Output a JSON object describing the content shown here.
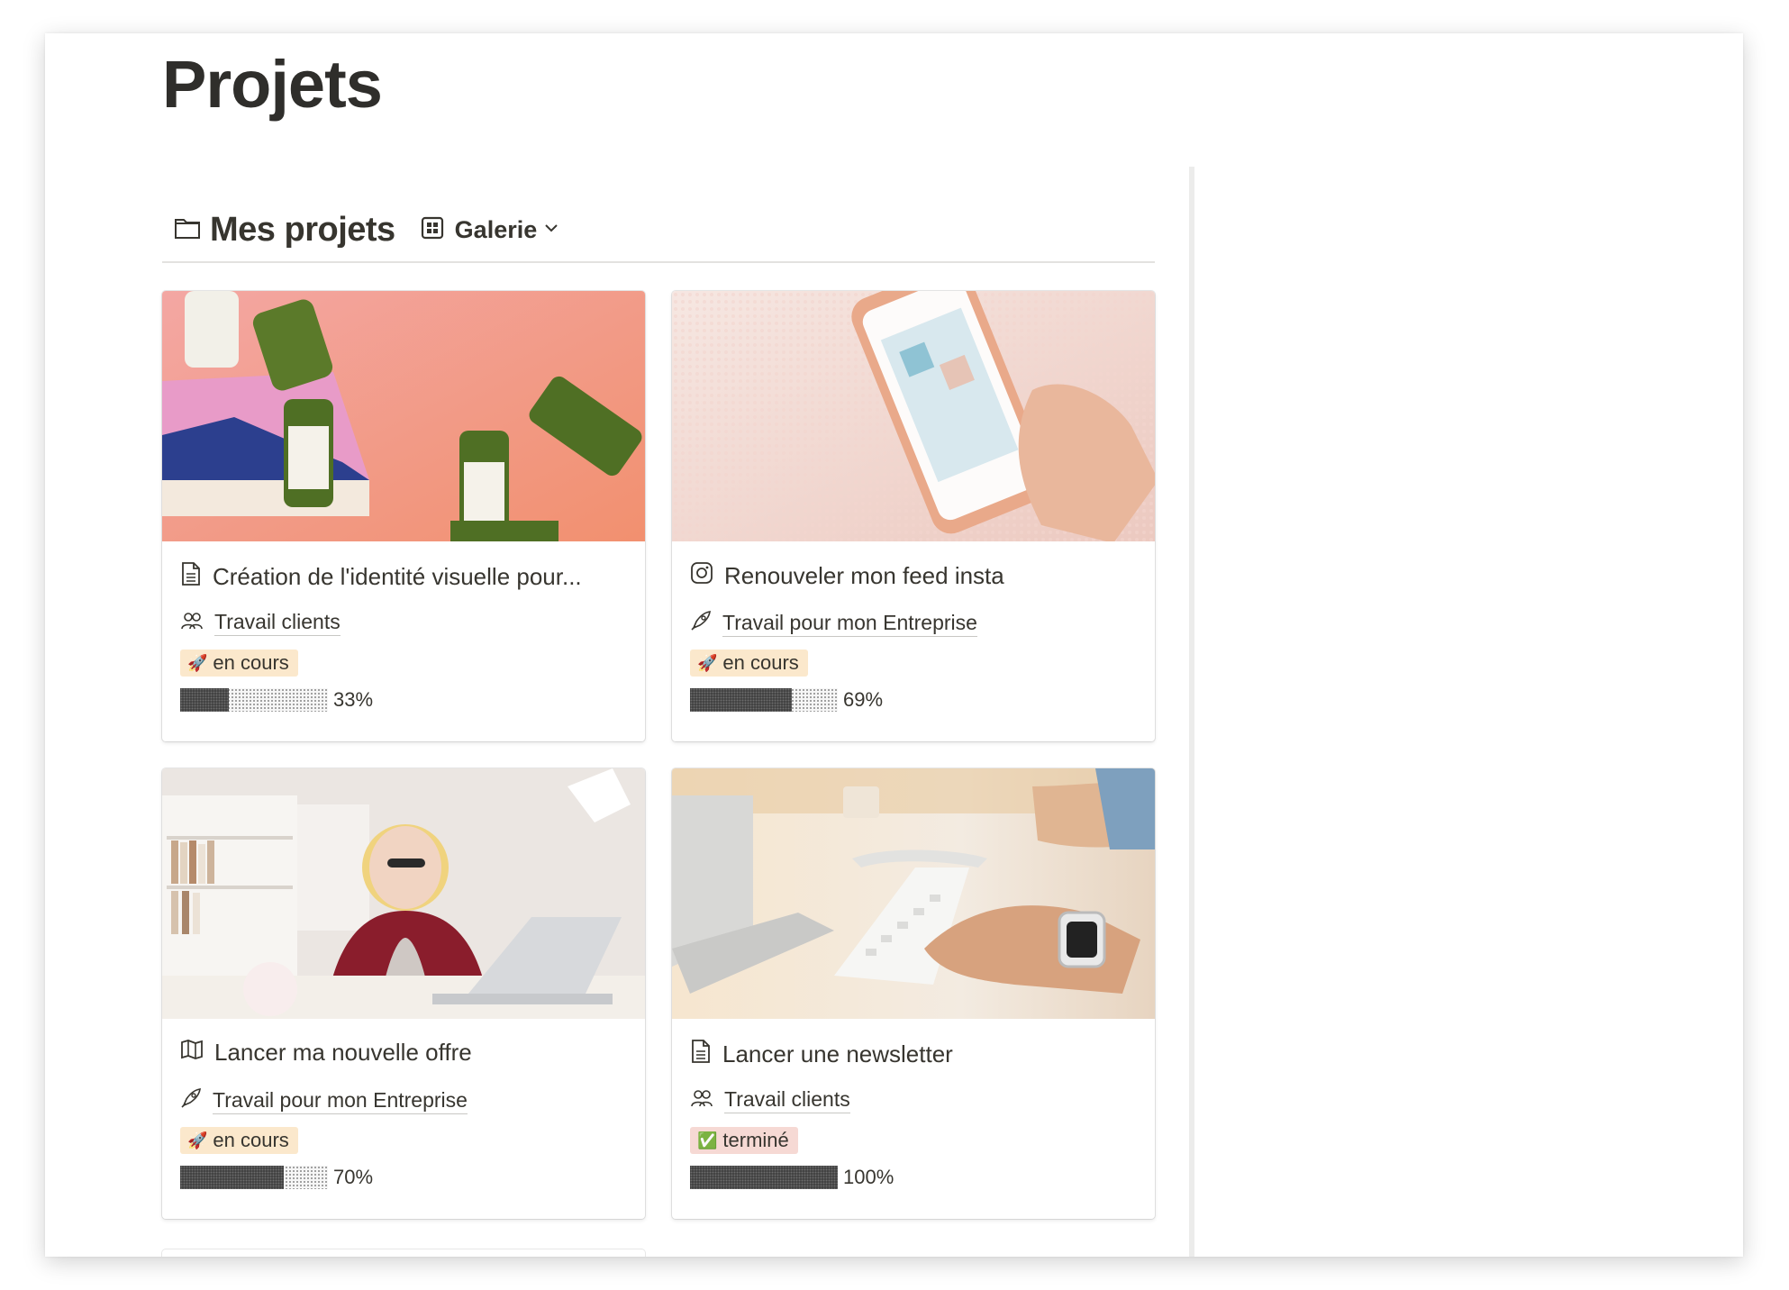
{
  "page": {
    "title": "Projets"
  },
  "database": {
    "title": "Mes projets",
    "view_label": "Galerie",
    "icons": {
      "db": "folder-icon",
      "view": "gallery-grid-icon",
      "dropdown": "chevron-down-icon"
    }
  },
  "cards": [
    {
      "title": "Création de l'identité visuelle pour...",
      "title_icon": "document-icon",
      "relation": "Travail clients",
      "relation_icon": "people-icon",
      "status": "en cours",
      "status_emoji": "🚀",
      "status_color": "#fbe8cc",
      "progress_value": 0.33,
      "progress": "33%",
      "cover": "juice-bottles-photo"
    },
    {
      "title": "Renouveler mon feed insta",
      "title_icon": "instagram-icon",
      "relation": "Travail pour mon Entreprise",
      "relation_icon": "rocket-icon",
      "status": "en cours",
      "status_emoji": "🚀",
      "status_color": "#fbe8cc",
      "progress_value": 0.69,
      "progress": "69%",
      "cover": "phone-instagram-photo"
    },
    {
      "title": "Lancer ma nouvelle offre",
      "title_icon": "map-icon",
      "relation": "Travail pour mon Entreprise",
      "relation_icon": "rocket-icon",
      "status": "en cours",
      "status_emoji": "🚀",
      "status_color": "#fbe8cc",
      "progress_value": 0.7,
      "progress": "70%",
      "cover": "woman-laptop-photo"
    },
    {
      "title": "Lancer une newsletter",
      "title_icon": "document-icon",
      "relation": "Travail clients",
      "relation_icon": "people-icon",
      "status": "terminé",
      "status_emoji": "✅",
      "status_color": "#f6d9d4",
      "progress_value": 1.0,
      "progress": "100%",
      "cover": "keyboard-desk-photo"
    }
  ]
}
